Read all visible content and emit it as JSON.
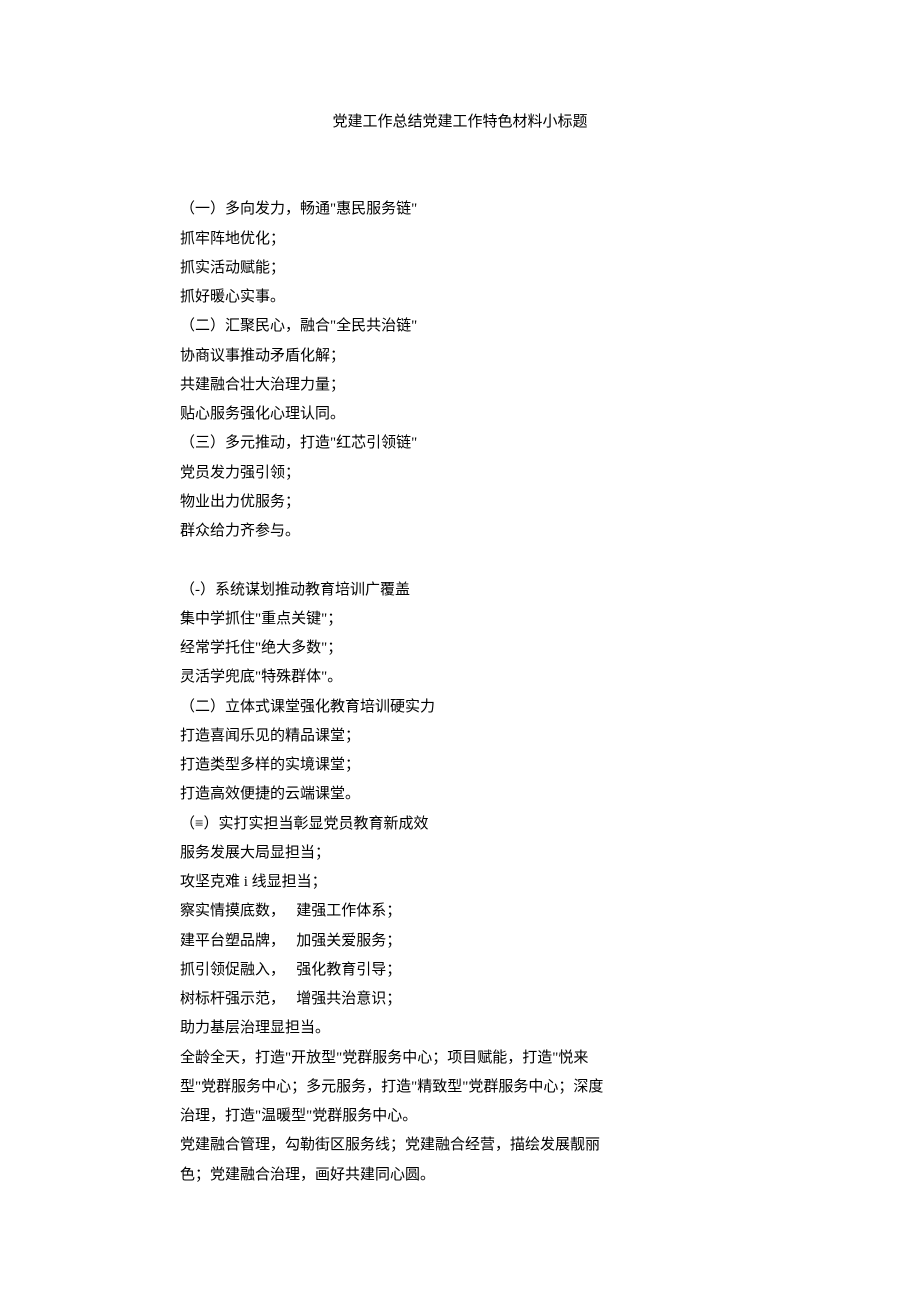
{
  "title": "党建工作总结党建工作特色材料小标题",
  "block1": {
    "h1": "（一）多向发力，畅通\"惠民服务链\"",
    "l1": "抓牢阵地优化；",
    "l2": "抓实活动赋能；",
    "l3": "抓好暖心实事。",
    "h2": "（二）汇聚民心，融合\"全民共治链\"",
    "l4": "协商议事推动矛盾化解；",
    "l5": "共建融合壮大治理力量；",
    "l6": "贴心服务强化心理认同。",
    "h3": "（三）多元推动，打造\"红芯引领链\"",
    "l7": "党员发力强引领；",
    "l8": "物业出力优服务；",
    "l9": "群众给力齐参与。"
  },
  "block2": {
    "h1": "（-）系统谋划推动教育培训广覆盖",
    "l1": "集中学抓住\"重点关键\"；",
    "l2": "经常学托住\"绝大多数\"；",
    "l3": "灵活学兜底\"特殊群体\"。",
    "h2": "（二）立体式课堂强化教育培训硬实力",
    "l4": "打造喜闻乐见的精品课堂；",
    "l5": "打造类型多样的实境课堂；",
    "l6": "打造高效便捷的云端课堂。",
    "h3": "（≡）实打实担当彰显党员教育新成效",
    "l7": "服务发展大局显担当；",
    "l8": "攻坚克难 i 线显担当；"
  },
  "block3": {
    "l1": "察实情摸底数，   建强工作体系；",
    "l2": "建平台塑品牌，   加强关爱服务；",
    "l3": "抓引领促融入，   强化教育引导；",
    "l4": "树标杆强示范，   增强共治意识；",
    "l5": "助力基层治理显担当。",
    "p1a": "全龄全天，打造\"开放型\"党群服务中心；项目赋能，打造\"悦来",
    "p1b": "型\"党群服务中心；多元服务，打造\"精致型\"党群服务中心；深度",
    "p1c": "治理，打造\"温暖型\"党群服务中心。",
    "p2a": "党建融合管理，勾勒街区服务线；党建融合经营，描绘发展靓丽",
    "p2b": "色；党建融合治理，画好共建同心圆。"
  }
}
